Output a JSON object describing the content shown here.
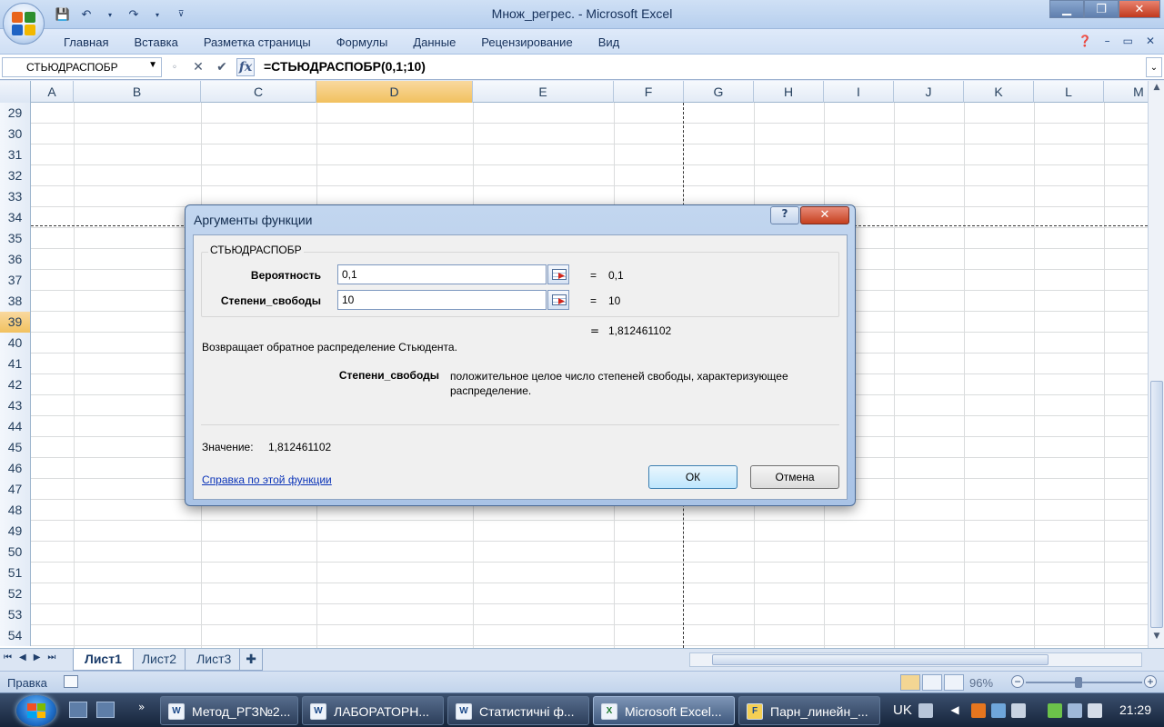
{
  "window": {
    "title": "Множ_регрес. - Microsoft Excel"
  },
  "ribbon": {
    "tabs": [
      "Главная",
      "Вставка",
      "Разметка страницы",
      "Формулы",
      "Данные",
      "Рецензирование",
      "Вид"
    ]
  },
  "formula_bar": {
    "name_box": "СТЬЮДРАСПОБР",
    "fx_label": "fx",
    "formula": "=СТЬЮДРАСПОБР(0,1;10)"
  },
  "grid": {
    "columns": [
      "A",
      "B",
      "C",
      "D",
      "E",
      "F",
      "G",
      "H",
      "I",
      "J",
      "K",
      "L",
      "M"
    ],
    "selected_column": "D",
    "rows": [
      "29",
      "30",
      "31",
      "32",
      "33",
      "34",
      "35",
      "36",
      "37",
      "38",
      "39",
      "40",
      "41",
      "42",
      "43",
      "44",
      "45",
      "46",
      "47",
      "48",
      "49",
      "50",
      "51",
      "52",
      "53",
      "54"
    ],
    "selected_row": "39"
  },
  "dialog": {
    "title": "Аргументы функции",
    "help_button": "?",
    "function_name": "СТЬЮДРАСПОБР",
    "args": [
      {
        "label": "Вероятность",
        "value": "0,1",
        "result": "0,1"
      },
      {
        "label": "Степени_свободы",
        "value": "10",
        "result": "10"
      }
    ],
    "equals": "=",
    "function_result": "1,812461102",
    "description": "Возвращает обратное распределение Стьюдента.",
    "arg_description_name": "Степени_свободы",
    "arg_description_text": "положительное целое число степеней свободы, характеризующее распределение.",
    "value_label": "Значение:",
    "value": "1,812461102",
    "help_link": "Справка по этой функции",
    "ok_label": "ОК",
    "cancel_label": "Отмена"
  },
  "sheets": {
    "tabs": [
      "Лист1",
      "Лист2",
      "Лист3"
    ],
    "active": "Лист1"
  },
  "status_bar": {
    "mode": "Правка",
    "zoom": "96%"
  },
  "taskbar": {
    "buttons": [
      {
        "label": "Метод_РГЗ№2...",
        "icon": "W"
      },
      {
        "label": "ЛАБОРАТОРН...",
        "icon": "W"
      },
      {
        "label": "Статистичні ф...",
        "icon": "W"
      },
      {
        "label": "Microsoft Excel...",
        "icon": "X"
      },
      {
        "label": "Парн_линейн_...",
        "icon": "F"
      }
    ],
    "language": "UK",
    "clock": "21:29"
  }
}
